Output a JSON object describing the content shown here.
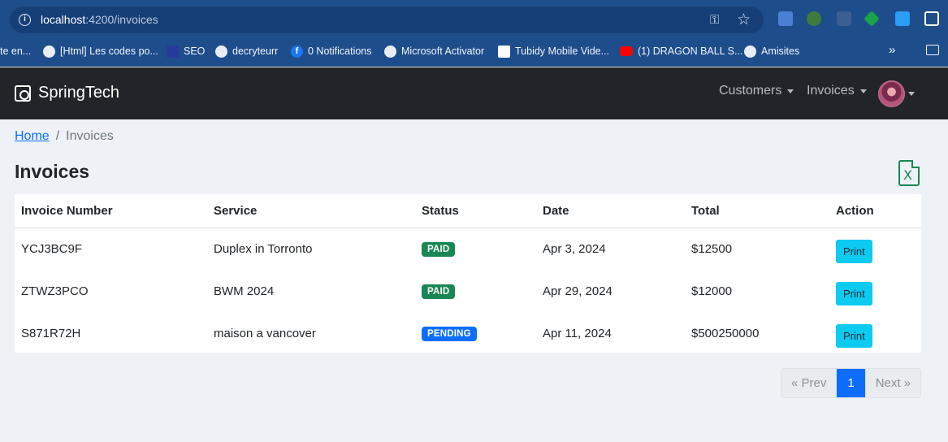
{
  "browser": {
    "url_host": "localhost",
    "url_rest": ":4200/invoices",
    "bookmarks": [
      {
        "label": "te en..."
      },
      {
        "label": "[Html] Les codes po..."
      },
      {
        "label": "SEO"
      },
      {
        "label": "decryteurr"
      },
      {
        "label": "0 Notifications"
      },
      {
        "label": "Microsoft Activator"
      },
      {
        "label": "Tubidy Mobile Vide..."
      },
      {
        "label": "(1) DRAGON BALL S..."
      },
      {
        "label": "Amisites"
      }
    ],
    "overflow": "»"
  },
  "navbar": {
    "brand": "SpringTech",
    "menu": [
      {
        "label": "Customers"
      },
      {
        "label": "Invoices"
      }
    ]
  },
  "breadcrumb": {
    "home": "Home",
    "separator": "/",
    "current": "Invoices"
  },
  "page": {
    "title": "Invoices",
    "export_icon_text": "X"
  },
  "table": {
    "headers": [
      "Invoice Number",
      "Service",
      "Status",
      "Date",
      "Total",
      "Action"
    ],
    "rows": [
      {
        "number": "YCJ3BC9F",
        "service": "Duplex in Torronto",
        "status": "PAID",
        "date": "Apr 3, 2024",
        "total": "$12500",
        "action": "Print"
      },
      {
        "number": "ZTWZ3PCO",
        "service": "BWM 2024",
        "status": "PAID",
        "date": "Apr 29, 2024",
        "total": "$12000",
        "action": "Print"
      },
      {
        "number": "S871R72H",
        "service": "maison a vancover",
        "status": "PENDING",
        "date": "Apr 11, 2024",
        "total": "$500250000",
        "action": "Print"
      }
    ]
  },
  "pagination": {
    "prev": "« Prev",
    "page": "1",
    "next": "Next »"
  },
  "colors": {
    "navbar_bg": "#212529",
    "paid_badge": "#198754",
    "pending_badge": "#0d6efd",
    "print_button": "#0dcaf0",
    "excel_icon": "#198754"
  }
}
